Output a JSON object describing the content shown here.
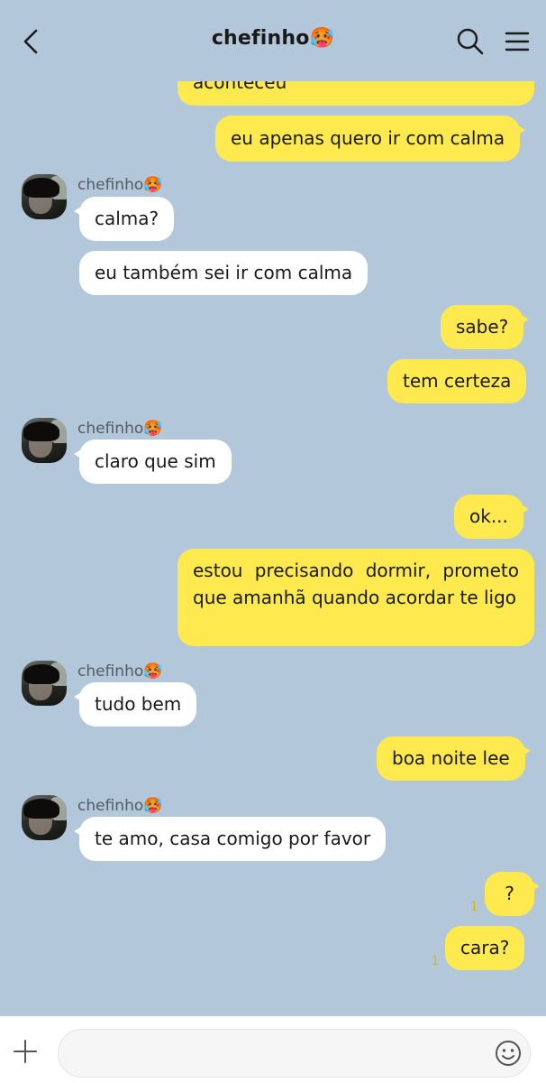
{
  "header": {
    "title": "chefinho",
    "title_emoji": "🥵"
  },
  "contact": {
    "name": "chefinho",
    "emoji": "🥵"
  },
  "messages": [
    {
      "from": "me",
      "text": "aconteceu",
      "partial": true
    },
    {
      "from": "me",
      "text": "eu apenas quero ir com calma"
    },
    {
      "from": "them",
      "text": "calma?"
    },
    {
      "from": "them",
      "text": "eu também sei ir com calma"
    },
    {
      "from": "me",
      "text": "sabe?"
    },
    {
      "from": "me",
      "text": "tem certeza"
    },
    {
      "from": "them",
      "text": "claro que sim"
    },
    {
      "from": "me",
      "text": "ok..."
    },
    {
      "from": "me",
      "text": "estou precisando dormir, prometo que amanhã quando acordar te ligo"
    },
    {
      "from": "them",
      "text": "tudo bem"
    },
    {
      "from": "me",
      "text": "boa noite lee"
    },
    {
      "from": "them",
      "text": "te amo, casa comigo por favor"
    },
    {
      "from": "me",
      "text": "?",
      "unread": "1"
    },
    {
      "from": "me",
      "text": "cara?",
      "unread": "1"
    }
  ],
  "input": {
    "placeholder": ""
  },
  "colors": {
    "background": "#b2c7d9",
    "my_bubble": "#fee94e",
    "their_bubble": "#ffffff",
    "unread": "#e1b400"
  },
  "icons": [
    "back-arrow-icon",
    "search-icon",
    "menu-icon",
    "plus-icon",
    "emoji-icon"
  ]
}
